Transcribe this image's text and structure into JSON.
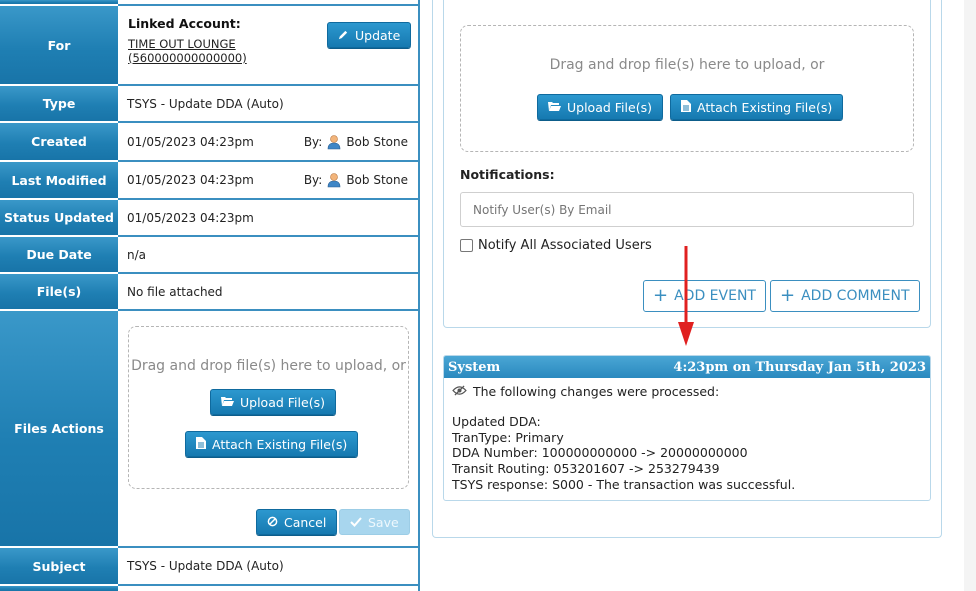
{
  "left": {
    "for": {
      "header": "For",
      "linked_label": "Linked Account:",
      "account_name": "TIME OUT LOUNGE",
      "account_number": "(560000000000000)",
      "update_button": "Update"
    },
    "rows": {
      "type": {
        "header": "Type",
        "value": "TSYS - Update DDA (Auto)"
      },
      "created": {
        "header": "Created",
        "value": "01/05/2023 04:23pm",
        "by_label": "By:",
        "by_user": "Bob Stone"
      },
      "last_modified": {
        "header": "Last Modified",
        "value": "01/05/2023 04:23pm",
        "by_label": "By:",
        "by_user": "Bob Stone"
      },
      "last_status": {
        "header": "Last Status Updated",
        "value": "01/05/2023 04:23pm"
      },
      "due_date": {
        "header": "Due Date",
        "value": "n/a"
      },
      "files": {
        "header": "File(s)",
        "value": "No file attached"
      },
      "subject": {
        "header": "Subject",
        "value": "TSYS - Update DDA (Auto)"
      }
    },
    "files_actions": {
      "header": "Files Actions",
      "dropzone_text": "Drag and drop file(s) here to upload, or",
      "upload_button": "Upload File(s)",
      "attach_button": "Attach Existing File(s)",
      "cancel_button": "Cancel",
      "save_button": "Save"
    }
  },
  "right": {
    "dropzone_text": "Drag and drop file(s) here to upload, or",
    "upload_button": "Upload File(s)",
    "attach_button": "Attach Existing File(s)",
    "notifications_label": "Notifications:",
    "notify_placeholder": "Notify User(s) By Email",
    "notify_all_label": "Notify All Associated Users",
    "add_event_button": "ADD EVENT",
    "add_comment_button": "ADD COMMENT",
    "event": {
      "source": "System",
      "time": "4:23pm on Thursday Jan 5th, 2023",
      "intro": "The following changes were processed:",
      "lines": [
        "Updated DDA:",
        "TranType: Primary",
        "DDA Number: 100000000000 -> 20000000000",
        "Transit Routing: 053201607 -> 253279439",
        "TSYS response: S000 - The transaction was successful."
      ]
    }
  },
  "colors": {
    "header_blue": "#1f7fb3",
    "border_blue": "#3b8fc0",
    "annotation_arrow": "#e02020"
  }
}
